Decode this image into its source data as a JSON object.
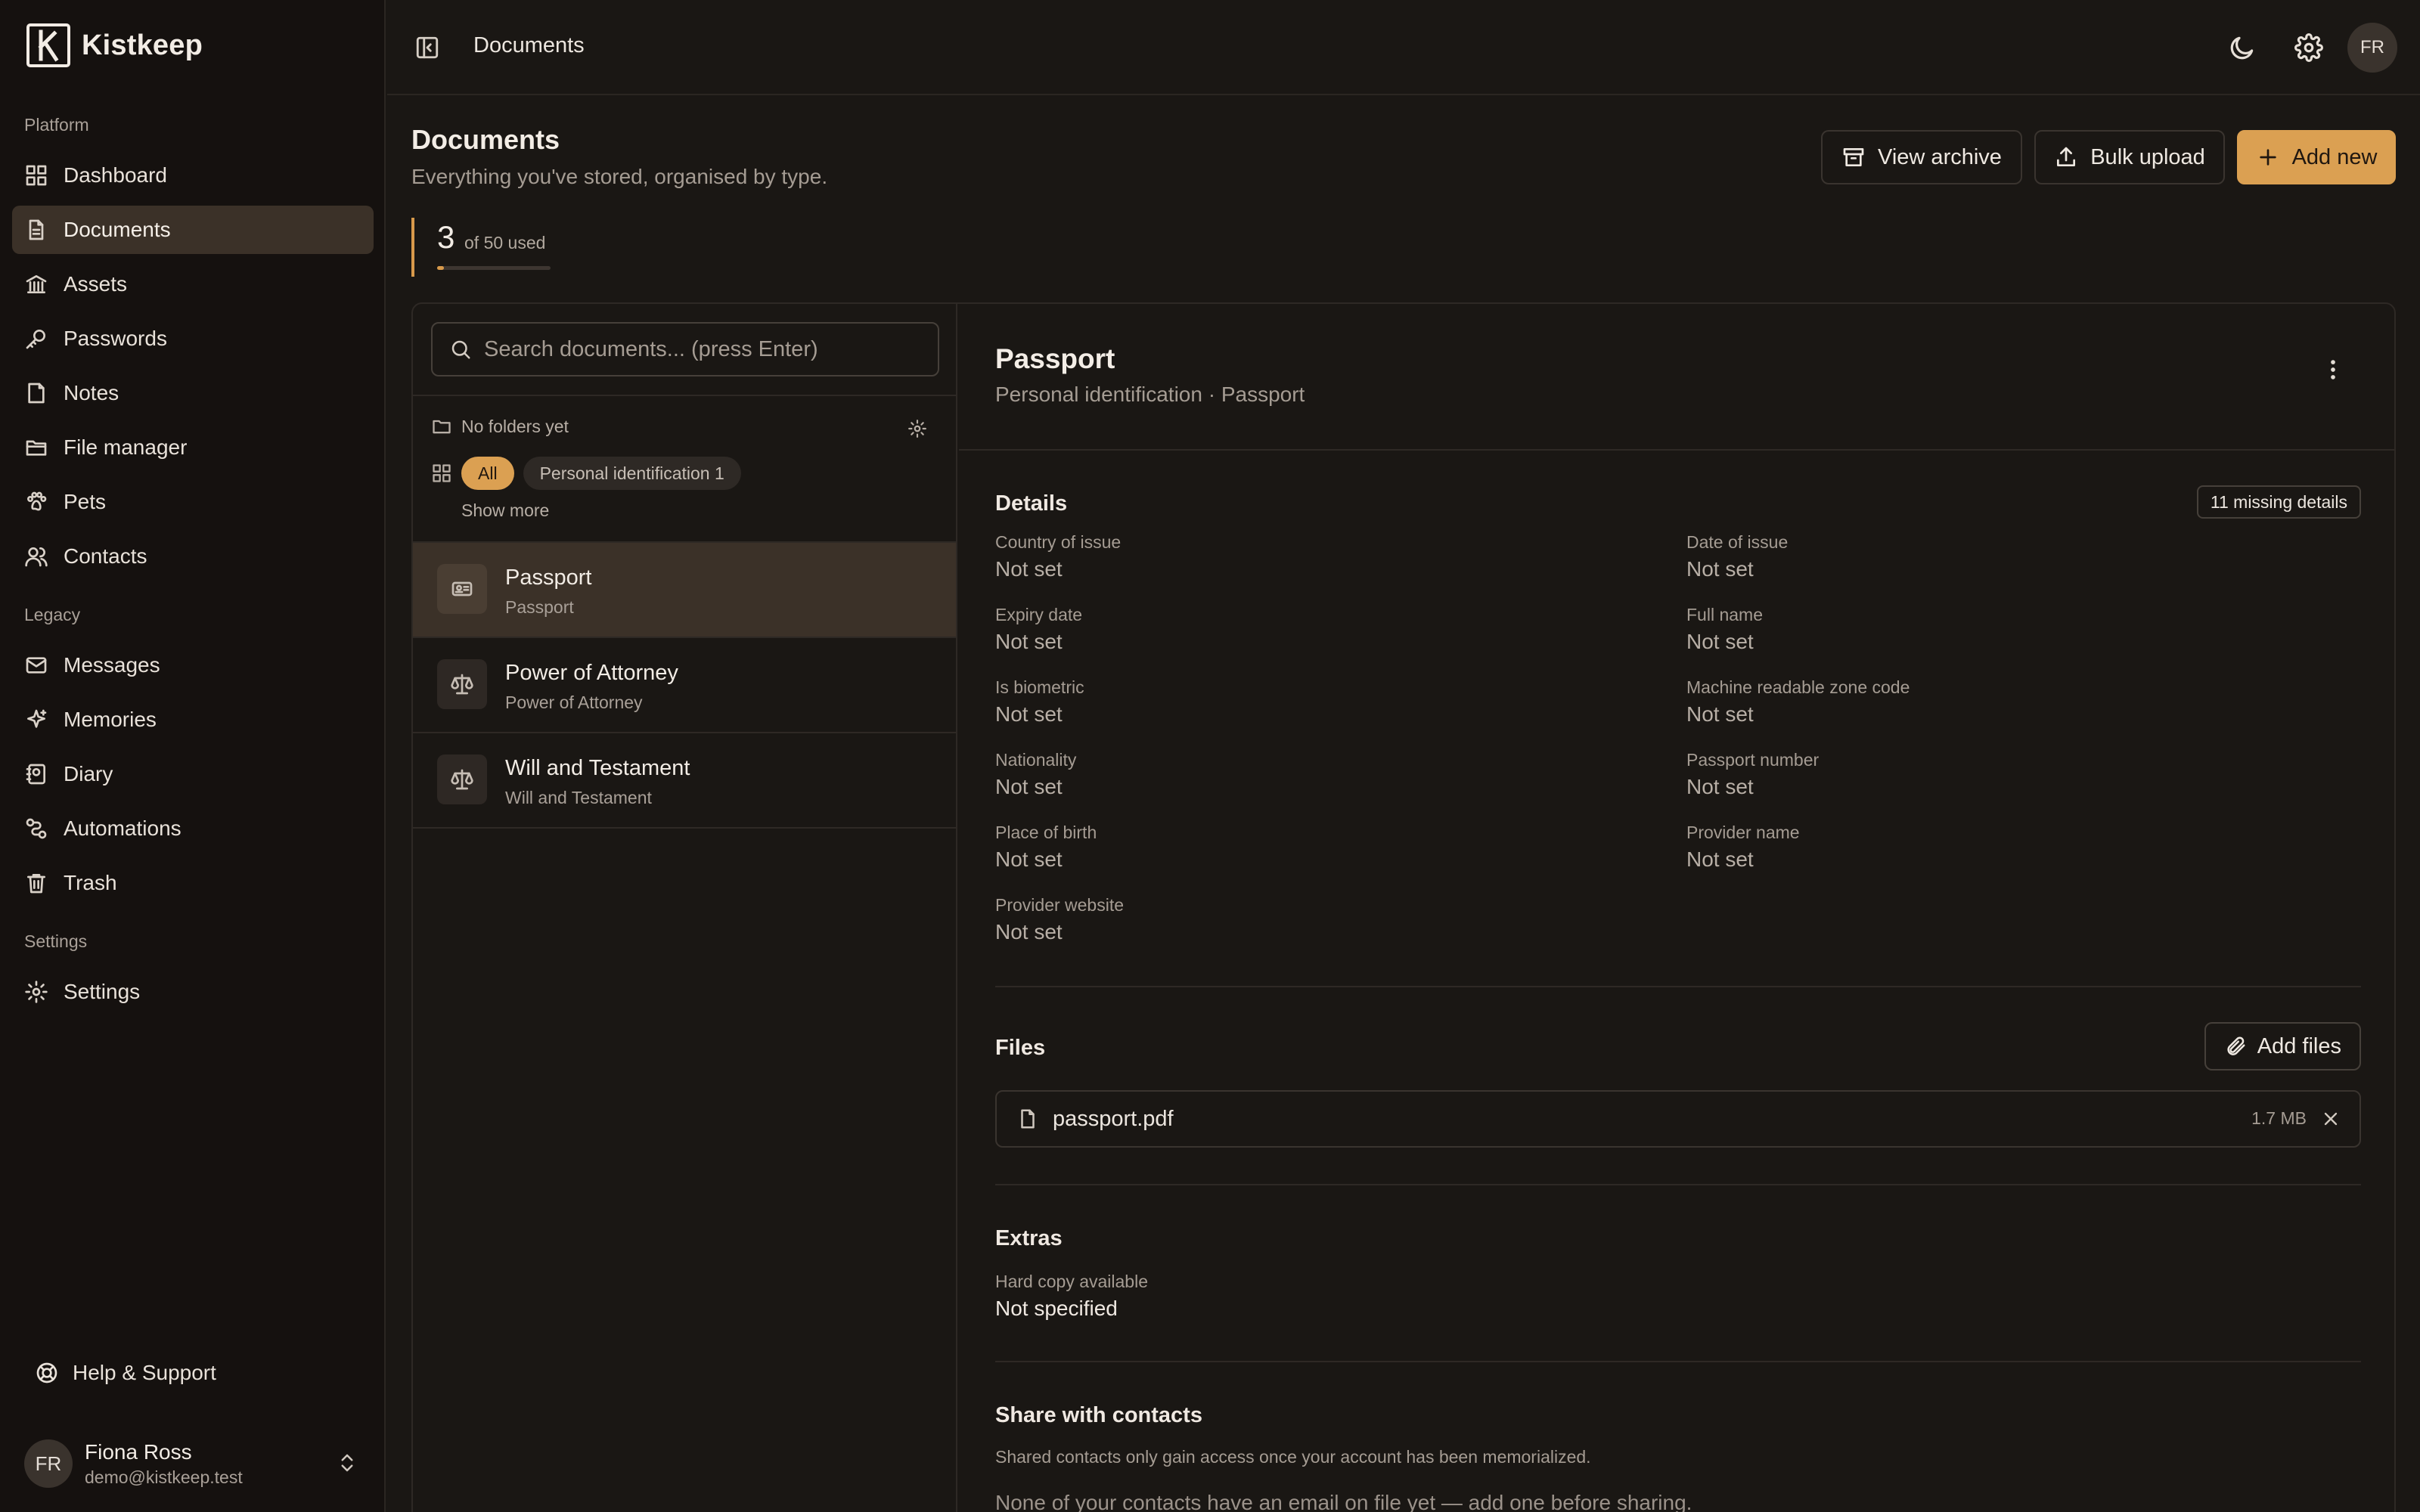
{
  "brand": {
    "name": "Kistkeep"
  },
  "sidebar": {
    "sections": {
      "platform": "Platform",
      "legacy": "Legacy",
      "settings": "Settings"
    },
    "platform_items": [
      {
        "label": "Dashboard",
        "icon": "dashboard-icon"
      },
      {
        "label": "Documents",
        "icon": "document-icon",
        "active": true
      },
      {
        "label": "Assets",
        "icon": "bank-icon"
      },
      {
        "label": "Passwords",
        "icon": "key-icon"
      },
      {
        "label": "Notes",
        "icon": "note-icon"
      },
      {
        "label": "File manager",
        "icon": "folder-icon"
      },
      {
        "label": "Pets",
        "icon": "paw-icon"
      },
      {
        "label": "Contacts",
        "icon": "users-icon"
      }
    ],
    "legacy_items": [
      {
        "label": "Messages",
        "icon": "mail-icon"
      },
      {
        "label": "Memories",
        "icon": "sparkle-icon"
      },
      {
        "label": "Diary",
        "icon": "book-icon"
      },
      {
        "label": "Automations",
        "icon": "workflow-icon"
      },
      {
        "label": "Trash",
        "icon": "trash-icon"
      }
    ],
    "settings_items": [
      {
        "label": "Settings",
        "icon": "gear-icon"
      }
    ],
    "help": "Help & Support",
    "user": {
      "initials": "FR",
      "name": "Fiona Ross",
      "email": "demo@kistkeep.test"
    }
  },
  "topbar": {
    "breadcrumb": "Documents",
    "avatar_initials": "FR"
  },
  "page": {
    "title": "Documents",
    "subtitle": "Everything you've stored, organised by type.",
    "buttons": {
      "view_archive": "View archive",
      "bulk_upload": "Bulk upload",
      "add_new": "Add new"
    },
    "usage": {
      "used": "3",
      "label": "of 50 used",
      "fraction": 0.06
    }
  },
  "list": {
    "search_placeholder": "Search documents... (press Enter)",
    "folders_text": "No folders yet",
    "chips": {
      "all": "All",
      "personal": "Personal identification 1"
    },
    "show_more": "Show more",
    "items": [
      {
        "title": "Passport",
        "sub": "Passport",
        "icon": "id-card-icon"
      },
      {
        "title": "Power of Attorney",
        "sub": "Power of Attorney",
        "icon": "scale-icon"
      },
      {
        "title": "Will and Testament",
        "sub": "Will and Testament",
        "icon": "scale-icon"
      }
    ]
  },
  "detail": {
    "title": "Passport",
    "subtitle": "Personal identification · Passport",
    "details_title": "Details",
    "missing_badge": "11 missing details",
    "fields": [
      {
        "label": "Country of issue",
        "value": "Not set"
      },
      {
        "label": "Date of issue",
        "value": "Not set"
      },
      {
        "label": "Expiry date",
        "value": "Not set"
      },
      {
        "label": "Full name",
        "value": "Not set"
      },
      {
        "label": "Is biometric",
        "value": "Not set"
      },
      {
        "label": "Machine readable zone code",
        "value": "Not set"
      },
      {
        "label": "Nationality",
        "value": "Not set"
      },
      {
        "label": "Passport number",
        "value": "Not set"
      },
      {
        "label": "Place of birth",
        "value": "Not set"
      },
      {
        "label": "Provider name",
        "value": "Not set"
      },
      {
        "label": "Provider website",
        "value": "Not set"
      }
    ],
    "files_title": "Files",
    "add_files": "Add files",
    "file": {
      "name": "passport.pdf",
      "size": "1.7 MB"
    },
    "extras_title": "Extras",
    "extras": {
      "label": "Hard copy available",
      "value": "Not specified"
    },
    "share_title": "Share with contacts",
    "share_note": "Shared contacts only gain access once your account has been memorialized.",
    "share_empty": "None of your contacts have an email on file yet — add one before sharing."
  },
  "colors": {
    "accent": "#dba052",
    "background": "#1a1714",
    "sidebar": "#15110f",
    "active": "#3b3128"
  }
}
